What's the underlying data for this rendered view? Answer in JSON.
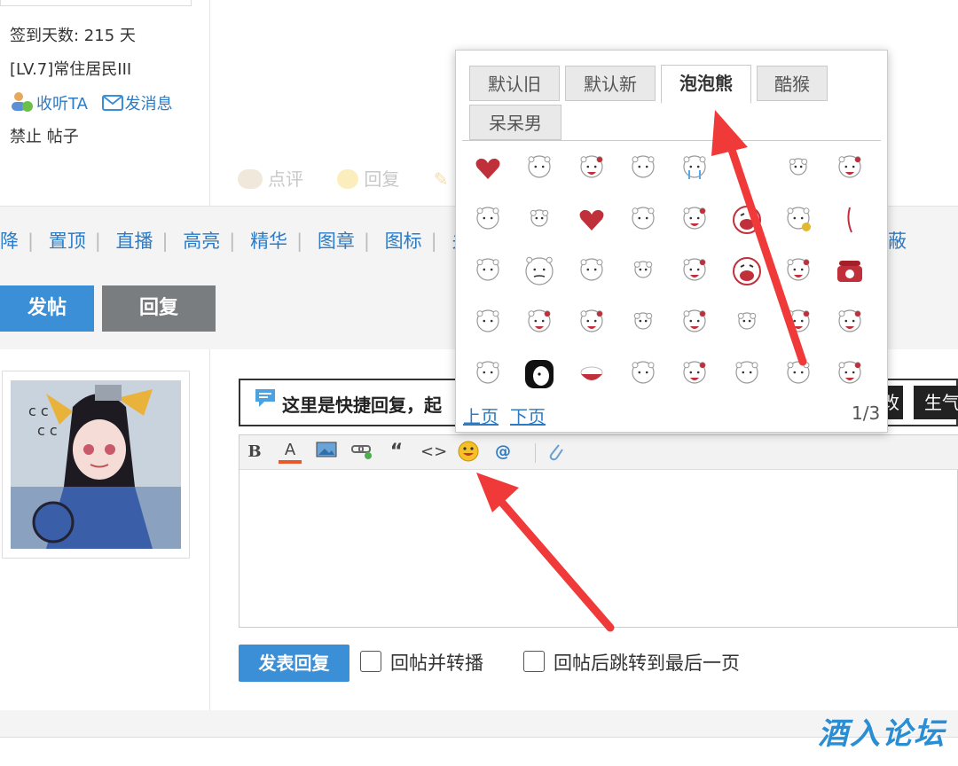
{
  "user": {
    "signin_days": "签到天数: 215 天",
    "level": "[LV.7]常住居民III",
    "follow": "收听TA",
    "message": "发消息",
    "ban": "禁止 帖子"
  },
  "post_actions": {
    "comment": "点评",
    "reply": "回复"
  },
  "mod_links": [
    "降",
    "置顶",
    "直播",
    "高亮",
    "精华",
    "图章",
    "图标",
    "关闭"
  ],
  "mod_last": "蔽",
  "buttons": {
    "post": "发帖",
    "reply": "回复"
  },
  "notice": {
    "text": "这里是快捷回复，起",
    "btn1": "改",
    "btn2": "生气"
  },
  "editor_toolbar": {
    "bold": "B",
    "font_color": "A",
    "quote": "“",
    "code": "<>",
    "at": "@"
  },
  "emoji_popup": {
    "tabs": [
      "默认旧",
      "默认新",
      "泡泡熊",
      "酷猴",
      "呆呆男"
    ],
    "active_tab": "泡泡熊",
    "prev": "上页",
    "next": "下页",
    "page": "1/3"
  },
  "submit": {
    "button": "发表回复",
    "option1": "回帖并转播",
    "option2": "回帖后跳转到最后一页"
  },
  "brand": "酒入论坛",
  "colors": {
    "link": "#2c7bc4",
    "primary_button": "#3b8fd6",
    "arrow": "#f03a3a"
  }
}
